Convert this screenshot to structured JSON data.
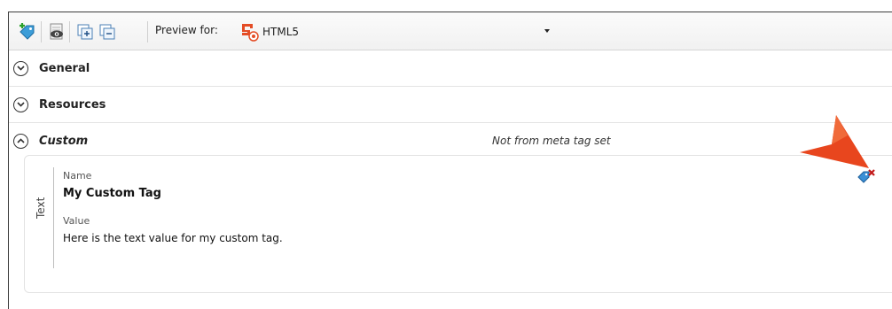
{
  "toolbar": {
    "buttons": [
      {
        "icon": "add-meta-tag-icon"
      },
      {
        "icon": "preview-eye-icon"
      },
      {
        "icon": "expand-all-icon"
      },
      {
        "icon": "collapse-all-icon"
      }
    ],
    "preview_label": "Preview for:",
    "preview_value": "HTML5",
    "preview_icon": "html5-target-icon"
  },
  "sections": {
    "general": {
      "title": "General",
      "state": "collapsed"
    },
    "resources": {
      "title": "Resources",
      "state": "collapsed"
    },
    "custom": {
      "title": "Custom",
      "state": "expanded",
      "note": "Not from meta tag set"
    }
  },
  "card": {
    "tab_label": "Text",
    "name_label": "Name",
    "name_value": "My Custom Tag",
    "value_label": "Value",
    "value_text": "Here is the text value for my custom tag.",
    "action_icon": "delete-tag-icon"
  },
  "colors": {
    "accent_arrow": "#e8461e",
    "html5_red": "#e44d26",
    "tag_blue": "#3b8fd6",
    "delete_red": "#c21818"
  }
}
